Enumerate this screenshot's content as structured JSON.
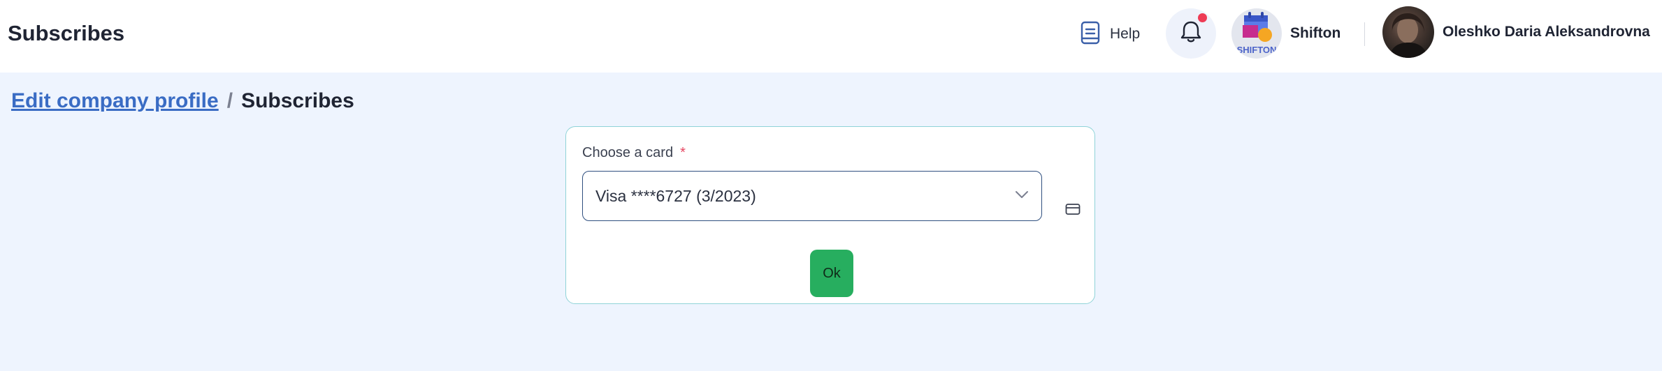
{
  "header": {
    "title": "Subscribes",
    "help_label": "Help",
    "company_name": "Shifton",
    "company_logo_text": "SHIFTON",
    "user_name": "Oleshko Daria Aleksandrovna",
    "notification_dot_color": "#ee3b55"
  },
  "breadcrumb": {
    "parent": "Edit company profile",
    "separator": "/",
    "current": "Subscribes"
  },
  "form": {
    "card_label": "Choose a card",
    "required_mark": "*",
    "selected_card": "Visa ****6727 (3/2023)",
    "ok_label": "Ok"
  },
  "colors": {
    "accent_green": "#27ae5f",
    "link_blue": "#3a6cc4",
    "page_background": "#eef4fe"
  }
}
